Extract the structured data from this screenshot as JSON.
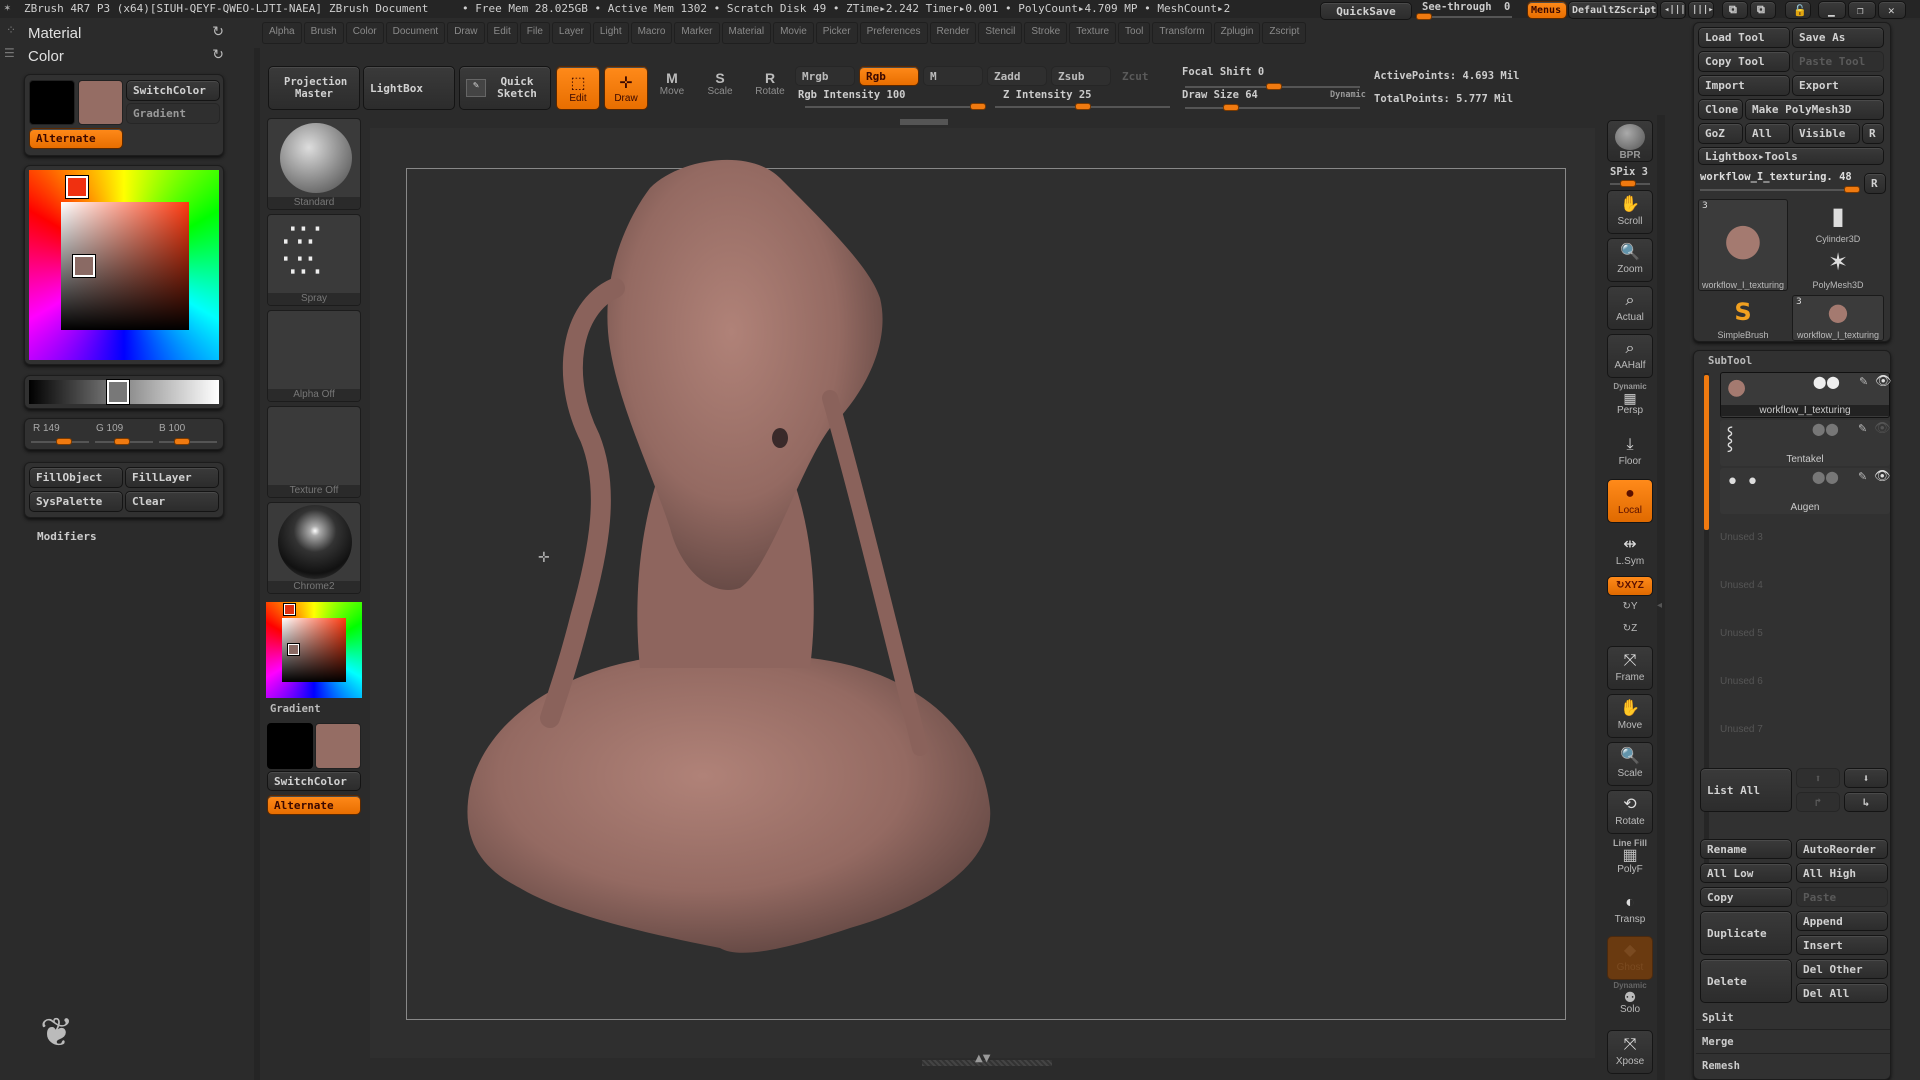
{
  "titlebar": {
    "app": "ZBrush 4R7 P3 (x64)[SIUH-QEYF-QWEO-LJTI-NAEA]",
    "document": "ZBrush Document",
    "stats": "• Free Mem 28.025GB • Active Mem 1302 • Scratch Disk 49 •  ZTime▸2.242  Timer▸0.001 • PolyCount▸4.709 MP  • MeshCount▸2",
    "quicksave": "QuickSave",
    "see_through_label": "See-through",
    "see_through_value": "0",
    "menus": "Menus",
    "default_zscript": "DefaultZScript"
  },
  "menubar": [
    "Alpha",
    "Brush",
    "Color",
    "Document",
    "Draw",
    "Edit",
    "File",
    "Layer",
    "Light",
    "Macro",
    "Marker",
    "Material",
    "Movie",
    "Picker",
    "Preferences",
    "Render",
    "Stencil",
    "Stroke",
    "Texture",
    "Tool",
    "Transform",
    "Zplugin",
    "Zscript"
  ],
  "left_panel": {
    "material_label": "Material",
    "color_label": "Color",
    "switch_color": "SwitchColor",
    "gradient": "Gradient",
    "alternate": "Alternate",
    "main_color": "#956d64",
    "secondary_color": "#000000",
    "rgb": {
      "r_label": "R 149",
      "g_label": "G 109",
      "b_label": "B 100",
      "r": 149,
      "g": 109,
      "b": 100
    },
    "fill_object": "FillObject",
    "fill_layer": "FillLayer",
    "sys_palette": "SysPalette",
    "clear": "Clear",
    "modifiers": "Modifiers"
  },
  "toolbar": {
    "projection_master": "Projection Master",
    "lightbox": "LightBox",
    "quick_sketch": "Quick Sketch",
    "edit": "Edit",
    "draw": "Draw",
    "move": "Move",
    "scale": "Scale",
    "rotate": "Rotate",
    "mrgb": "Mrgb",
    "rgb": "Rgb",
    "m": "M",
    "zadd": "Zadd",
    "zsub": "Zsub",
    "zcut": "Zcut",
    "rgb_intensity": "Rgb Intensity 100",
    "rgb_intensity_value": 100,
    "z_intensity": "Z Intensity 25",
    "z_intensity_value": 25,
    "focal_shift": "Focal Shift 0",
    "focal_shift_value": 0,
    "draw_size": "Draw Size 64",
    "draw_size_value": 64,
    "dynamic": "Dynamic",
    "active_points": "ActivePoints: 4.693 Mil",
    "total_points": "TotalPoints: 5.777 Mil"
  },
  "left_shelf": {
    "brush": "Standard",
    "stroke": "Spray",
    "alpha": "Alpha Off",
    "texture": "Texture Off",
    "material": "Chrome2",
    "gradient": "Gradient",
    "switch_color": "SwitchColor",
    "alternate": "Alternate"
  },
  "right_shelf": {
    "bpr": "BPR",
    "spix": "SPix 3",
    "scroll": "Scroll",
    "zoom": "Zoom",
    "actual": "Actual",
    "aahalf": "AAHalf",
    "dynamic_persp_top": "Dynamic",
    "persp": "Persp",
    "floor": "Floor",
    "local": "Local",
    "lsym": "L.Sym",
    "xyz": "XYZ",
    "y": "Y",
    "z": "Z",
    "frame": "Frame",
    "move": "Move",
    "scale": "Scale",
    "rotate": "Rotate",
    "line_fill": "Line Fill",
    "polyf": "PolyF",
    "transp": "Transp",
    "ghost": "Ghost",
    "dynamic_solo_top": "Dynamic",
    "solo": "Solo",
    "xpose": "Xpose"
  },
  "tool_palette": {
    "load_tool": "Load Tool",
    "save_as": "Save As",
    "copy_tool": "Copy Tool",
    "paste_tool": "Paste Tool",
    "import": "Import",
    "export": "Export",
    "clone": "Clone",
    "make_polymesh": "Make PolyMesh3D",
    "goz": "GoZ",
    "all": "All",
    "visible": "Visible",
    "r": "R",
    "lightbox_tools": "Lightbox▸Tools",
    "current_tool": "workflow_I_texturing. 48",
    "tools": [
      {
        "name": "workflow_I_texturing",
        "badge": "3"
      },
      {
        "name": "Cylinder3D",
        "badge": ""
      },
      {
        "name": "PolyMesh3D",
        "badge": ""
      },
      {
        "name": "SimpleBrush",
        "badge": ""
      },
      {
        "name": "workflow_I_texturing",
        "badge": "3"
      }
    ]
  },
  "subtool": {
    "title": "SubTool",
    "items": [
      {
        "name": "workflow_I_texturing",
        "selected": true
      },
      {
        "name": "Tentakel",
        "selected": false
      },
      {
        "name": "Augen",
        "selected": false
      }
    ],
    "unused": [
      "Unused 3",
      "Unused 4",
      "Unused 5",
      "Unused 6",
      "Unused 7"
    ],
    "list_all": "List All",
    "rename": "Rename",
    "auto_reorder": "AutoReorder",
    "all_low": "All Low",
    "all_high": "All High",
    "copy": "Copy",
    "paste": "Paste",
    "duplicate": "Duplicate",
    "append": "Append",
    "insert": "Insert",
    "delete": "Delete",
    "del_other": "Del Other",
    "del_all": "Del All",
    "split": "Split",
    "merge": "Merge",
    "remesh": "Remesh"
  },
  "colors": {
    "accent": "#f07a10",
    "model": "#9a6e66",
    "bg": "#2b2b2b"
  }
}
